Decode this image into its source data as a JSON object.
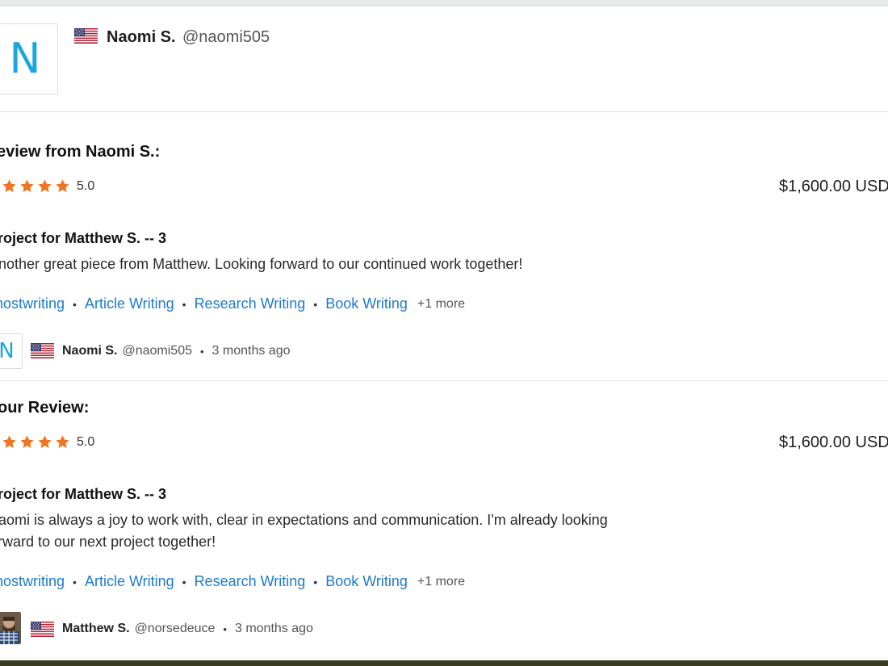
{
  "header": {
    "avatar_letter": "N",
    "name": "Naomi S.",
    "handle": "@naomi505"
  },
  "reviews": [
    {
      "title": "eview from Naomi S.:",
      "rating": "5.0",
      "stars": 5,
      "amount": "$1,600.00 USD",
      "project": "roject for Matthew S. -- 3",
      "description": "nother great piece from Matthew. Looking forward to our continued work together!",
      "tags": [
        "nostwriting",
        "Article Writing",
        "Research Writing",
        "Book Writing"
      ],
      "more": "+1 more",
      "author": {
        "avatar_letter": "N",
        "name": "Naomi S.",
        "handle": "@naomi505",
        "time": "3 months ago"
      }
    },
    {
      "title": "our Review:",
      "rating": "5.0",
      "stars": 5,
      "amount": "$1,600.00 USD",
      "project": "roject for Matthew S. -- 3",
      "description_line1": "aomi is always a joy to work with, clear in expectations and communication. I'm already looking",
      "description_line2": "rward to our next project together!",
      "tags": [
        "nostwriting",
        "Article Writing",
        "Research Writing",
        "Book Writing"
      ],
      "more": "+1 more",
      "author": {
        "name": "Matthew S.",
        "handle": "@norsedeuce",
        "time": "3 months ago"
      }
    }
  ],
  "colors": {
    "accent_link": "#1f7acc",
    "star": "#f07522",
    "avatar_letter": "#1aa6e0"
  }
}
